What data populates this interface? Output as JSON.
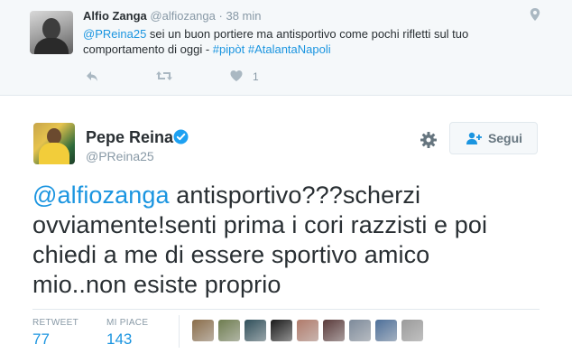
{
  "reply": {
    "name": "Alfio Zanga",
    "handle": "@alfiozanga",
    "dot": "·",
    "time": "38 min",
    "mention": "@PReina25",
    "text_line1": " sei un buon portiere ma antisportivo come pochi rifletti sul tuo",
    "text_line2": "comportamento di oggi - ",
    "hashtag1": "#pipòt",
    "hashtag2": "#AtalantaNapoli",
    "like_count": "1"
  },
  "tweet": {
    "name": "Pepe Reina",
    "handle": "@PReina25",
    "follow_label": "Segui",
    "mention": "@alfiozanga",
    "text_line1": " antisportivo???scherzi",
    "text_line2": "ovviamente!senti prima i cori razzisti e poi",
    "text_line3": "chiedi a me di essere sportivo amico",
    "text_line4": "mio..non esiste proprio"
  },
  "stats": {
    "retweet_label": "RETWEET",
    "retweet_value": "77",
    "likes_label": "MI PIACE",
    "likes_value": "143"
  },
  "likers": [
    {
      "name": "liker-avatar-1",
      "color": "#8a6d4a"
    },
    {
      "name": "liker-avatar-2",
      "color": "#6e7c4f"
    },
    {
      "name": "liker-avatar-3",
      "color": "#2f4f5a"
    },
    {
      "name": "liker-avatar-4",
      "color": "#1a1a1a"
    },
    {
      "name": "liker-avatar-5",
      "color": "#b07a6a"
    },
    {
      "name": "liker-avatar-6",
      "color": "#5a3a3a"
    },
    {
      "name": "liker-avatar-7",
      "color": "#7d8a9a"
    },
    {
      "name": "liker-avatar-8",
      "color": "#4d6f99"
    },
    {
      "name": "liker-avatar-9",
      "color": "#9a9a9a"
    }
  ],
  "colors": {
    "link": "#1b95e0",
    "secondary_text": "#8899a6",
    "primary_text": "#292f33",
    "reply_background": "#f5f8fa"
  }
}
